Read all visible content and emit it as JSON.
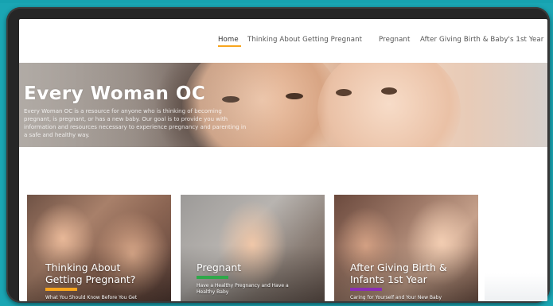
{
  "nav": {
    "items": [
      {
        "label": "Home",
        "active": true
      },
      {
        "label": "Thinking About Getting Pregnant",
        "active": false
      },
      {
        "label": "Pregnant",
        "active": false
      },
      {
        "label": "After Giving Birth & Baby's 1st Year",
        "active": false
      }
    ],
    "accent_color": "#f7a51e"
  },
  "hero": {
    "title": "Every Woman OC",
    "description": "Every Woman OC is a resource for anyone who is thinking of becoming pregnant, is pregnant, or has a new baby. Our goal is to provide you with information and resources necessary to experience pregnancy and parenting in a safe and healthy way."
  },
  "cards": [
    {
      "title_line1": "Thinking About",
      "title_line2": "Getting Pregnant?",
      "subtitle": "What You Should Know Before You Get",
      "bar_color": "#f7a51e"
    },
    {
      "title_line1": "Pregnant",
      "title_line2": "",
      "subtitle": "Have a Healthy Pregnancy and Have a Healthy Baby",
      "bar_color": "#2ea84a"
    },
    {
      "title_line1": "After Giving Birth &",
      "title_line2": "Infants 1st Year",
      "subtitle": "Caring for Yourself and Your New Baby",
      "bar_color": "#8a2eb5"
    }
  ]
}
